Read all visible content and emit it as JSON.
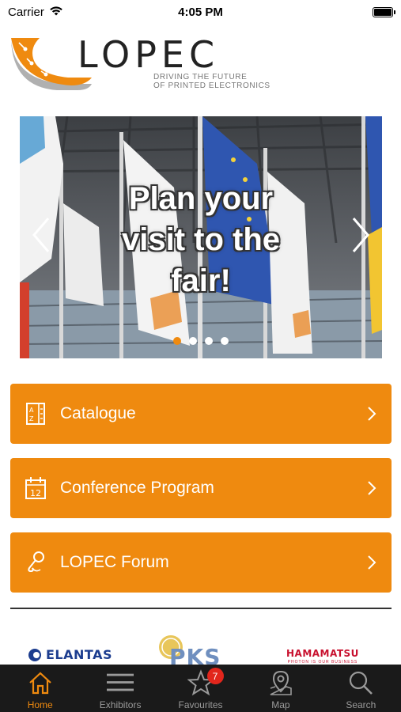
{
  "status_bar": {
    "carrier": "Carrier",
    "time": "4:05 PM",
    "battery_level": 1.0
  },
  "logo": {
    "wordmark": "LOPEC",
    "tagline_1": "DRIVING THE FUTURE",
    "tagline_2": "OF PRINTED ELECTRONICS",
    "brand_color": "#ef8a0f"
  },
  "carousel": {
    "caption_lines": [
      "Plan your",
      "visit to the",
      "fair!"
    ],
    "slide_count": 4,
    "active_slide": 1,
    "prev_icon": "chevron-left-icon",
    "next_icon": "chevron-right-icon"
  },
  "menu": {
    "color": "#ef8a0f",
    "items": [
      {
        "label": "Catalogue",
        "icon": "a-z-catalogue-icon"
      },
      {
        "label": "Conference Program",
        "icon": "calendar-icon"
      },
      {
        "label": "LOPEC Forum",
        "icon": "microphone-icon"
      }
    ]
  },
  "sponsors": {
    "elantas": "ELANTAS",
    "pks": "PKS",
    "hamamatsu": "HAMAMATSU",
    "hamamatsu_tagline": "PHOTON IS OUR BUSINESS"
  },
  "tab_bar": {
    "active_color": "#ef8a0f",
    "tabs": [
      {
        "label": "Home",
        "icon": "home-icon",
        "active": true
      },
      {
        "label": "Exhibitors",
        "icon": "list-icon",
        "active": false
      },
      {
        "label": "Favourites",
        "icon": "star-icon",
        "active": false,
        "badge": "7"
      },
      {
        "label": "Map",
        "icon": "map-pin-icon",
        "active": false
      },
      {
        "label": "Search",
        "icon": "search-icon",
        "active": false
      }
    ]
  }
}
